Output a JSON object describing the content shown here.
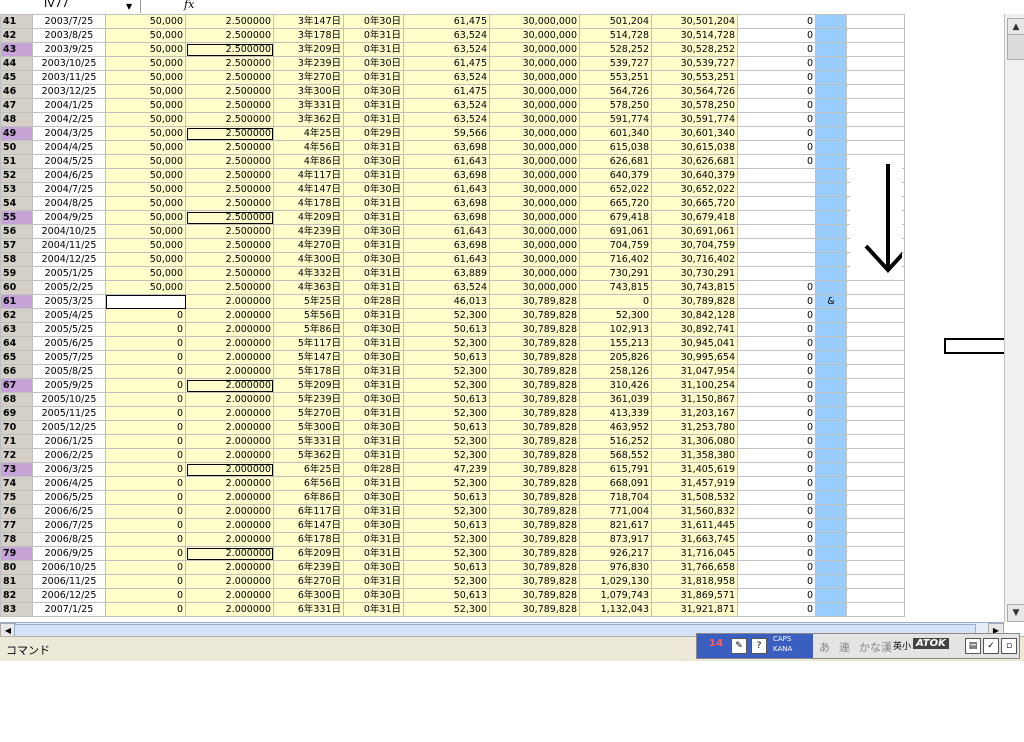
{
  "namebox": {
    "value": "IV77",
    "fx": "fx"
  },
  "rows": [
    {
      "n": "41",
      "date": "2003/7/25",
      "amt": "50,000",
      "rate": "2.500000",
      "period": "3年147日",
      "days": "0年30日",
      "interest": "61,475",
      "principal": "30,000,000",
      "accum": "501,204",
      "total": "30,501,204",
      "zero": "0",
      "hl": false,
      "box": false,
      "yd": true
    },
    {
      "n": "42",
      "date": "2003/8/25",
      "amt": "50,000",
      "rate": "2.500000",
      "period": "3年178日",
      "days": "0年31日",
      "interest": "63,524",
      "principal": "30,000,000",
      "accum": "514,728",
      "total": "30,514,728",
      "zero": "0",
      "hl": false,
      "box": false,
      "yd": true
    },
    {
      "n": "43",
      "date": "2003/9/25",
      "amt": "50,000",
      "rate": "2.500000",
      "period": "3年209日",
      "days": "0年31日",
      "interest": "63,524",
      "principal": "30,000,000",
      "accum": "528,252",
      "total": "30,528,252",
      "zero": "0",
      "hl": true,
      "box": true,
      "yd": true
    },
    {
      "n": "44",
      "date": "2003/10/25",
      "amt": "50,000",
      "rate": "2.500000",
      "period": "3年239日",
      "days": "0年30日",
      "interest": "61,475",
      "principal": "30,000,000",
      "accum": "539,727",
      "total": "30,539,727",
      "zero": "0",
      "hl": false,
      "box": false,
      "yd": true
    },
    {
      "n": "45",
      "date": "2003/11/25",
      "amt": "50,000",
      "rate": "2.500000",
      "period": "3年270日",
      "days": "0年31日",
      "interest": "63,524",
      "principal": "30,000,000",
      "accum": "553,251",
      "total": "30,553,251",
      "zero": "0",
      "hl": false,
      "box": false,
      "yd": true
    },
    {
      "n": "46",
      "date": "2003/12/25",
      "amt": "50,000",
      "rate": "2.500000",
      "period": "3年300日",
      "days": "0年30日",
      "interest": "61,475",
      "principal": "30,000,000",
      "accum": "564,726",
      "total": "30,564,726",
      "zero": "0",
      "hl": false,
      "box": false,
      "yd": true
    },
    {
      "n": "47",
      "date": "2004/1/25",
      "amt": "50,000",
      "rate": "2.500000",
      "period": "3年331日",
      "days": "0年31日",
      "interest": "63,524",
      "principal": "30,000,000",
      "accum": "578,250",
      "total": "30,578,250",
      "zero": "0",
      "hl": false,
      "box": false,
      "yd": true
    },
    {
      "n": "48",
      "date": "2004/2/25",
      "amt": "50,000",
      "rate": "2.500000",
      "period": "3年362日",
      "days": "0年31日",
      "interest": "63,524",
      "principal": "30,000,000",
      "accum": "591,774",
      "total": "30,591,774",
      "zero": "0",
      "hl": false,
      "box": false,
      "yd": true
    },
    {
      "n": "49",
      "date": "2004/3/25",
      "amt": "50,000",
      "rate": "2.500000",
      "period": "4年25日",
      "days": "0年29日",
      "interest": "59,566",
      "principal": "30,000,000",
      "accum": "601,340",
      "total": "30,601,340",
      "zero": "0",
      "hl": true,
      "box": true,
      "yd": true
    },
    {
      "n": "50",
      "date": "2004/4/25",
      "amt": "50,000",
      "rate": "2.500000",
      "period": "4年56日",
      "days": "0年31日",
      "interest": "63,698",
      "principal": "30,000,000",
      "accum": "615,038",
      "total": "30,615,038",
      "zero": "0",
      "hl": false,
      "box": false,
      "yd": true
    },
    {
      "n": "51",
      "date": "2004/5/25",
      "amt": "50,000",
      "rate": "2.500000",
      "period": "4年86日",
      "days": "0年30日",
      "interest": "61,643",
      "principal": "30,000,000",
      "accum": "626,681",
      "total": "30,626,681",
      "zero": "0",
      "hl": false,
      "box": false,
      "yd": true
    },
    {
      "n": "52",
      "date": "2004/6/25",
      "amt": "50,000",
      "rate": "2.500000",
      "period": "4年117日",
      "days": "0年31日",
      "interest": "63,698",
      "principal": "30,000,000",
      "accum": "640,379",
      "total": "30,640,379",
      "zero": "",
      "hl": false,
      "box": false,
      "yd": true
    },
    {
      "n": "53",
      "date": "2004/7/25",
      "amt": "50,000",
      "rate": "2.500000",
      "period": "4年147日",
      "days": "0年30日",
      "interest": "61,643",
      "principal": "30,000,000",
      "accum": "652,022",
      "total": "30,652,022",
      "zero": "",
      "hl": false,
      "box": false,
      "yd": true
    },
    {
      "n": "54",
      "date": "2004/8/25",
      "amt": "50,000",
      "rate": "2.500000",
      "period": "4年178日",
      "days": "0年31日",
      "interest": "63,698",
      "principal": "30,000,000",
      "accum": "665,720",
      "total": "30,665,720",
      "zero": "",
      "hl": false,
      "box": false,
      "yd": true
    },
    {
      "n": "55",
      "date": "2004/9/25",
      "amt": "50,000",
      "rate": "2.500000",
      "period": "4年209日",
      "days": "0年31日",
      "interest": "63,698",
      "principal": "30,000,000",
      "accum": "679,418",
      "total": "30,679,418",
      "zero": "",
      "hl": true,
      "box": true,
      "yd": true
    },
    {
      "n": "56",
      "date": "2004/10/25",
      "amt": "50,000",
      "rate": "2.500000",
      "period": "4年239日",
      "days": "0年30日",
      "interest": "61,643",
      "principal": "30,000,000",
      "accum": "691,061",
      "total": "30,691,061",
      "zero": "",
      "hl": false,
      "box": false,
      "yd": true
    },
    {
      "n": "57",
      "date": "2004/11/25",
      "amt": "50,000",
      "rate": "2.500000",
      "period": "4年270日",
      "days": "0年31日",
      "interest": "63,698",
      "principal": "30,000,000",
      "accum": "704,759",
      "total": "30,704,759",
      "zero": "",
      "hl": false,
      "box": false,
      "yd": true
    },
    {
      "n": "58",
      "date": "2004/12/25",
      "amt": "50,000",
      "rate": "2.500000",
      "period": "4年300日",
      "days": "0年30日",
      "interest": "61,643",
      "principal": "30,000,000",
      "accum": "716,402",
      "total": "30,716,402",
      "zero": "",
      "hl": false,
      "box": false,
      "yd": true
    },
    {
      "n": "59",
      "date": "2005/1/25",
      "amt": "50,000",
      "rate": "2.500000",
      "period": "4年332日",
      "days": "0年31日",
      "interest": "63,889",
      "principal": "30,000,000",
      "accum": "730,291",
      "total": "30,730,291",
      "zero": "",
      "hl": false,
      "box": false,
      "yd": true
    },
    {
      "n": "60",
      "date": "2005/2/25",
      "amt": "50,000",
      "rate": "2.500000",
      "period": "4年363日",
      "days": "0年31日",
      "interest": "63,524",
      "principal": "30,000,000",
      "accum": "743,815",
      "total": "30,743,815",
      "zero": "0",
      "hl": false,
      "box": false,
      "yd": true
    },
    {
      "n": "61",
      "date": "2005/3/25",
      "amt": "",
      "rate": "2.000000",
      "period": "5年25日",
      "days": "0年28日",
      "interest": "46,013",
      "principal": "30,789,828",
      "accum": "0",
      "total": "30,789,828",
      "zero": "0",
      "hl": true,
      "box": false,
      "yd": false,
      "amp": "&"
    },
    {
      "n": "62",
      "date": "2005/4/25",
      "amt": "0",
      "rate": "2.000000",
      "period": "5年56日",
      "days": "0年31日",
      "interest": "52,300",
      "principal": "30,789,828",
      "accum": "52,300",
      "total": "30,842,128",
      "zero": "0",
      "hl": false,
      "box": false,
      "yd": false
    },
    {
      "n": "63",
      "date": "2005/5/25",
      "amt": "0",
      "rate": "2.000000",
      "period": "5年86日",
      "days": "0年30日",
      "interest": "50,613",
      "principal": "30,789,828",
      "accum": "102,913",
      "total": "30,892,741",
      "zero": "0",
      "hl": false,
      "box": false,
      "yd": false
    },
    {
      "n": "64",
      "date": "2005/6/25",
      "amt": "0",
      "rate": "2.000000",
      "period": "5年117日",
      "days": "0年31日",
      "interest": "52,300",
      "principal": "30,789,828",
      "accum": "155,213",
      "total": "30,945,041",
      "zero": "0",
      "hl": false,
      "box": false,
      "yd": false
    },
    {
      "n": "65",
      "date": "2005/7/25",
      "amt": "0",
      "rate": "2.000000",
      "period": "5年147日",
      "days": "0年30日",
      "interest": "50,613",
      "principal": "30,789,828",
      "accum": "205,826",
      "total": "30,995,654",
      "zero": "0",
      "hl": false,
      "box": false,
      "yd": false
    },
    {
      "n": "66",
      "date": "2005/8/25",
      "amt": "0",
      "rate": "2.000000",
      "period": "5年178日",
      "days": "0年31日",
      "interest": "52,300",
      "principal": "30,789,828",
      "accum": "258,126",
      "total": "31,047,954",
      "zero": "0",
      "hl": false,
      "box": false,
      "yd": false
    },
    {
      "n": "67",
      "date": "2005/9/25",
      "amt": "0",
      "rate": "2.000000",
      "period": "5年209日",
      "days": "0年31日",
      "interest": "52,300",
      "principal": "30,789,828",
      "accum": "310,426",
      "total": "31,100,254",
      "zero": "0",
      "hl": true,
      "box": true,
      "yd": false
    },
    {
      "n": "68",
      "date": "2005/10/25",
      "amt": "0",
      "rate": "2.000000",
      "period": "5年239日",
      "days": "0年30日",
      "interest": "50,613",
      "principal": "30,789,828",
      "accum": "361,039",
      "total": "31,150,867",
      "zero": "0",
      "hl": false,
      "box": false,
      "yd": false
    },
    {
      "n": "69",
      "date": "2005/11/25",
      "amt": "0",
      "rate": "2.000000",
      "period": "5年270日",
      "days": "0年31日",
      "interest": "52,300",
      "principal": "30,789,828",
      "accum": "413,339",
      "total": "31,203,167",
      "zero": "0",
      "hl": false,
      "box": false,
      "yd": false
    },
    {
      "n": "70",
      "date": "2005/12/25",
      "amt": "0",
      "rate": "2.000000",
      "period": "5年300日",
      "days": "0年30日",
      "interest": "50,613",
      "principal": "30,789,828",
      "accum": "463,952",
      "total": "31,253,780",
      "zero": "0",
      "hl": false,
      "box": false,
      "yd": false
    },
    {
      "n": "71",
      "date": "2006/1/25",
      "amt": "0",
      "rate": "2.000000",
      "period": "5年331日",
      "days": "0年31日",
      "interest": "52,300",
      "principal": "30,789,828",
      "accum": "516,252",
      "total": "31,306,080",
      "zero": "0",
      "hl": false,
      "box": false,
      "yd": false
    },
    {
      "n": "72",
      "date": "2006/2/25",
      "amt": "0",
      "rate": "2.000000",
      "period": "5年362日",
      "days": "0年31日",
      "interest": "52,300",
      "principal": "30,789,828",
      "accum": "568,552",
      "total": "31,358,380",
      "zero": "0",
      "hl": false,
      "box": false,
      "yd": false
    },
    {
      "n": "73",
      "date": "2006/3/25",
      "amt": "0",
      "rate": "2.000000",
      "period": "6年25日",
      "days": "0年28日",
      "interest": "47,239",
      "principal": "30,789,828",
      "accum": "615,791",
      "total": "31,405,619",
      "zero": "0",
      "hl": true,
      "box": true,
      "yd": false
    },
    {
      "n": "74",
      "date": "2006/4/25",
      "amt": "0",
      "rate": "2.000000",
      "period": "6年56日",
      "days": "0年31日",
      "interest": "52,300",
      "principal": "30,789,828",
      "accum": "668,091",
      "total": "31,457,919",
      "zero": "0",
      "hl": false,
      "box": false,
      "yd": false
    },
    {
      "n": "75",
      "date": "2006/5/25",
      "amt": "0",
      "rate": "2.000000",
      "period": "6年86日",
      "days": "0年30日",
      "interest": "50,613",
      "principal": "30,789,828",
      "accum": "718,704",
      "total": "31,508,532",
      "zero": "0",
      "hl": false,
      "box": false,
      "yd": false
    },
    {
      "n": "76",
      "date": "2006/6/25",
      "amt": "0",
      "rate": "2.000000",
      "period": "6年117日",
      "days": "0年31日",
      "interest": "52,300",
      "principal": "30,789,828",
      "accum": "771,004",
      "total": "31,560,832",
      "zero": "0",
      "hl": false,
      "box": false,
      "yd": false
    },
    {
      "n": "77",
      "date": "2006/7/25",
      "amt": "0",
      "rate": "2.000000",
      "period": "6年147日",
      "days": "0年30日",
      "interest": "50,613",
      "principal": "30,789,828",
      "accum": "821,617",
      "total": "31,611,445",
      "zero": "0",
      "hl": false,
      "box": false,
      "yd": false
    },
    {
      "n": "78",
      "date": "2006/8/25",
      "amt": "0",
      "rate": "2.000000",
      "period": "6年178日",
      "days": "0年31日",
      "interest": "52,300",
      "principal": "30,789,828",
      "accum": "873,917",
      "total": "31,663,745",
      "zero": "0",
      "hl": false,
      "box": false,
      "yd": false
    },
    {
      "n": "79",
      "date": "2006/9/25",
      "amt": "0",
      "rate": "2.000000",
      "period": "6年209日",
      "days": "0年31日",
      "interest": "52,300",
      "principal": "30,789,828",
      "accum": "926,217",
      "total": "31,716,045",
      "zero": "0",
      "hl": true,
      "box": true,
      "yd": false
    },
    {
      "n": "80",
      "date": "2006/10/25",
      "amt": "0",
      "rate": "2.000000",
      "period": "6年239日",
      "days": "0年30日",
      "interest": "50,613",
      "principal": "30,789,828",
      "accum": "976,830",
      "total": "31,766,658",
      "zero": "0",
      "hl": false,
      "box": false,
      "yd": false
    },
    {
      "n": "81",
      "date": "2006/11/25",
      "amt": "0",
      "rate": "2.000000",
      "period": "6年270日",
      "days": "0年31日",
      "interest": "52,300",
      "principal": "30,789,828",
      "accum": "1,029,130",
      "total": "31,818,958",
      "zero": "0",
      "hl": false,
      "box": false,
      "yd": false
    },
    {
      "n": "82",
      "date": "2006/12/25",
      "amt": "0",
      "rate": "2.000000",
      "period": "6年300日",
      "days": "0年30日",
      "interest": "50,613",
      "principal": "30,789,828",
      "accum": "1,079,743",
      "total": "31,869,571",
      "zero": "0",
      "hl": false,
      "box": false,
      "yd": false
    },
    {
      "n": "83",
      "date": "2007/1/25",
      "amt": "0",
      "rate": "2.000000",
      "period": "6年331日",
      "days": "0年31日",
      "interest": "52,300",
      "principal": "30,789,828",
      "accum": "1,132,043",
      "total": "31,921,871",
      "zero": "0",
      "hl": false,
      "box": false,
      "yd": false
    }
  ],
  "statusbar": {
    "mode": "コマンド"
  },
  "ime": {
    "num": "14",
    "caps": "CAPS",
    "kana": "KANA",
    "hira": "あ",
    "ren": "連",
    "kanakan": "かな漢",
    "eisho": "英小",
    "atok": "ATOK"
  },
  "colors": {
    "yellow_cell": "#ffffcc",
    "row_highlight": "#c7a4d8",
    "blue_column": "#99ccff",
    "header_gray": "#d4d0c8"
  }
}
